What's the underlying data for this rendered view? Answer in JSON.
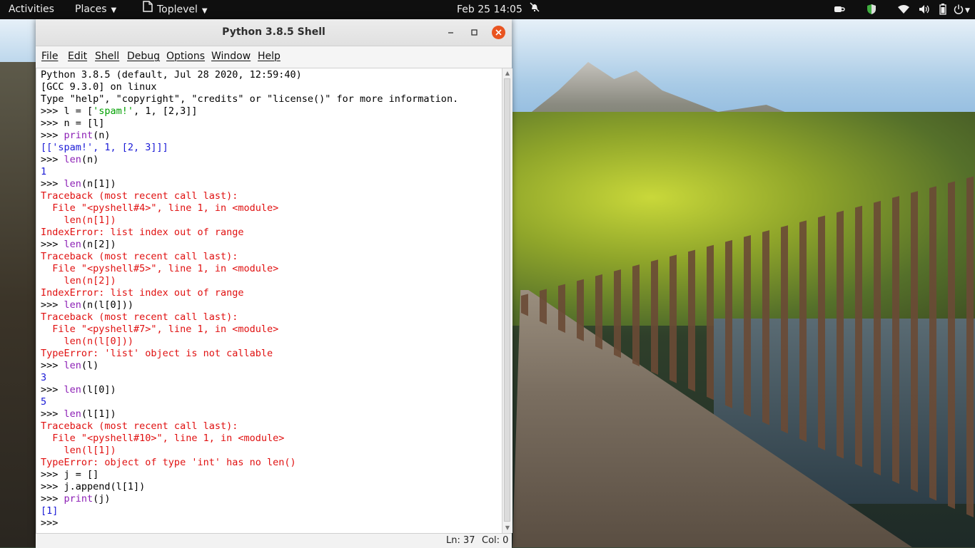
{
  "topbar": {
    "activities": "Activities",
    "places": "Places",
    "app_menu": "Toplevel",
    "clock": "Feb 25  14:05"
  },
  "window": {
    "title": "Python 3.8.5 Shell",
    "menu": [
      "File",
      "Edit",
      "Shell",
      "Debug",
      "Options",
      "Window",
      "Help"
    ],
    "status": {
      "line": "Ln: 37",
      "col": "Col: 0"
    }
  },
  "shell_lines": [
    {
      "text": "Python 3.8.5 (default, Jul 28 2020, 12:59:40)",
      "kind": "out"
    },
    {
      "text": "[GCC 9.3.0] on linux",
      "kind": "out"
    },
    {
      "text": "Type \"help\", \"copyright\", \"credits\" or \"license()\" for more information.",
      "kind": "out"
    },
    {
      "text": ">>> l = ['spam!', 1, [2,3]]",
      "kind": "prompt"
    },
    {
      "text": ">>> n = [l]",
      "kind": "prompt"
    },
    {
      "text": ">>> print(n)",
      "kind": "prompt"
    },
    {
      "text": "[['spam!', 1, [2, 3]]]",
      "kind": "blue"
    },
    {
      "text": ">>> len(n)",
      "kind": "prompt"
    },
    {
      "text": "1",
      "kind": "blue"
    },
    {
      "text": ">>> len(n[1])",
      "kind": "prompt"
    },
    {
      "text": "Traceback (most recent call last):",
      "kind": "red"
    },
    {
      "text": "  File \"<pyshell#4>\", line 1, in <module>",
      "kind": "red"
    },
    {
      "text": "    len(n[1])",
      "kind": "red"
    },
    {
      "text": "IndexError: list index out of range",
      "kind": "red"
    },
    {
      "text": ">>> len(n[2])",
      "kind": "prompt"
    },
    {
      "text": "Traceback (most recent call last):",
      "kind": "red"
    },
    {
      "text": "  File \"<pyshell#5>\", line 1, in <module>",
      "kind": "red"
    },
    {
      "text": "    len(n[2])",
      "kind": "red"
    },
    {
      "text": "IndexError: list index out of range",
      "kind": "red"
    },
    {
      "text": ">>> len(n(l[0]))",
      "kind": "prompt"
    },
    {
      "text": "Traceback (most recent call last):",
      "kind": "red"
    },
    {
      "text": "  File \"<pyshell#7>\", line 1, in <module>",
      "kind": "red"
    },
    {
      "text": "    len(n(l[0]))",
      "kind": "red"
    },
    {
      "text": "TypeError: 'list' object is not callable",
      "kind": "red"
    },
    {
      "text": ">>> len(l)",
      "kind": "prompt"
    },
    {
      "text": "3",
      "kind": "blue"
    },
    {
      "text": ">>> len(l[0])",
      "kind": "prompt"
    },
    {
      "text": "5",
      "kind": "blue"
    },
    {
      "text": ">>> len(l[1])",
      "kind": "prompt"
    },
    {
      "text": "Traceback (most recent call last):",
      "kind": "red"
    },
    {
      "text": "  File \"<pyshell#10>\", line 1, in <module>",
      "kind": "red"
    },
    {
      "text": "    len(l[1])",
      "kind": "red"
    },
    {
      "text": "TypeError: object of type 'int' has no len()",
      "kind": "red"
    },
    {
      "text": ">>> j = []",
      "kind": "prompt"
    },
    {
      "text": ">>> j.append(l[1])",
      "kind": "prompt"
    },
    {
      "text": ">>> print(j)",
      "kind": "prompt"
    },
    {
      "text": "[1]",
      "kind": "blue"
    },
    {
      "text": ">>> ",
      "kind": "prompt"
    }
  ],
  "icons": {
    "app_icon": "document-icon",
    "notifications": "bell-off-icon",
    "tray": [
      "coffee-icon",
      "shield-icon",
      "wifi-icon",
      "volume-icon",
      "battery-icon",
      "power-icon"
    ]
  },
  "colors": {
    "prompt": "#000000",
    "output": "#1a1ad6",
    "error": "#e01010",
    "string": "#00a000",
    "builtin": "#8c1fb5",
    "close_button": "#e95420"
  }
}
